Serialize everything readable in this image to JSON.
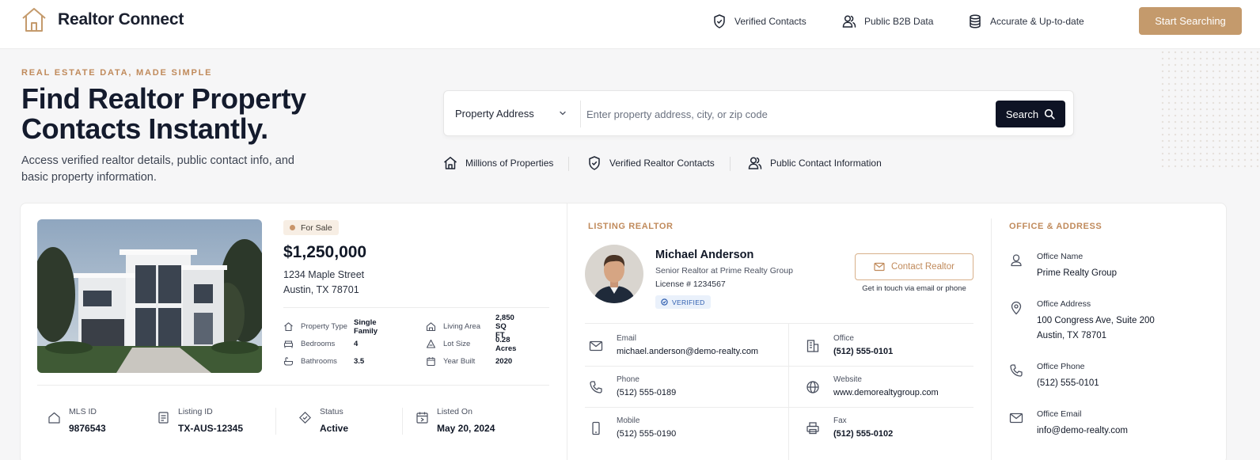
{
  "header": {
    "brand": "Realtor Connect",
    "features": [
      "Verified Contacts",
      "Public B2B Data",
      "Accurate & Up-to-date"
    ],
    "cta_label": "Start Searching"
  },
  "hero": {
    "eyebrow": "REAL ESTATE DATA, MADE SIMPLE",
    "title_line1": "Find Realtor Property",
    "title_line2": "Contacts Instantly.",
    "subtitle": "Access verified realtor details, public contact info, and basic property information."
  },
  "search": {
    "type_selected": "Property Address",
    "placeholder": "Enter property address, city, or zip code",
    "value": "",
    "button_label": "Search"
  },
  "trust": [
    "Millions of Properties",
    "Verified Realtor Contacts",
    "Public Contact Information"
  ],
  "property": {
    "status": "For Sale",
    "price": "$1,250,000",
    "street": "1234 Maple Street",
    "city": "Austin, TX 78701",
    "specs": [
      {
        "label": "Property Type",
        "value": "Single Family"
      },
      {
        "label": "Bedrooms",
        "value": "4"
      },
      {
        "label": "Bathrooms",
        "value": "3.5"
      },
      {
        "label": "Living Area",
        "value": "2,850 SQ FT"
      },
      {
        "label": "Lot Size",
        "value": "0.28 Acres"
      },
      {
        "label": "Year Built",
        "value": "2020"
      }
    ],
    "meta": [
      {
        "label": "MLS ID",
        "value": "9876543"
      },
      {
        "label": "Listing ID",
        "value": "TX-AUS-12345"
      },
      {
        "label": "Status",
        "value": "Active"
      },
      {
        "label": "Listed On",
        "value": "May 20, 2024"
      }
    ]
  },
  "realtor": {
    "section_title": "LISTING REALTOR",
    "name": "Michael Anderson",
    "title": "Senior Realtor at Prime Realty Group",
    "license": "License # 1234567",
    "verified": "VERIFIED",
    "contact_label": "Contact Realtor",
    "contact_hint": "Get in touch via email or phone",
    "contacts": [
      {
        "label": "Email",
        "value": "michael.anderson@demo-realty.com"
      },
      {
        "label": "Office",
        "value": "(512) 555-0101"
      },
      {
        "label": "Phone",
        "value": "(512) 555-0189"
      },
      {
        "label": "Website",
        "value": "www.demorealtygroup.com"
      },
      {
        "label": "Mobile",
        "value": "(512) 555-0190"
      },
      {
        "label": "Fax",
        "value": "(512) 555-0102"
      }
    ]
  },
  "office": {
    "section_title": "OFFICE & ADDRESS",
    "items": [
      {
        "label": "Office Name",
        "value": "Prime Realty Group"
      },
      {
        "label": "Office Address",
        "value": "100 Congress Ave, Suite 200\nAustin, TX 78701"
      },
      {
        "label": "Office Phone",
        "value": "(512) 555-0101"
      },
      {
        "label": "Office Email",
        "value": "info@demo-realty.com"
      }
    ]
  },
  "colors": {
    "accent": "#c49a6c",
    "dark": "#0e1324",
    "verified": "#2f5fb0"
  }
}
